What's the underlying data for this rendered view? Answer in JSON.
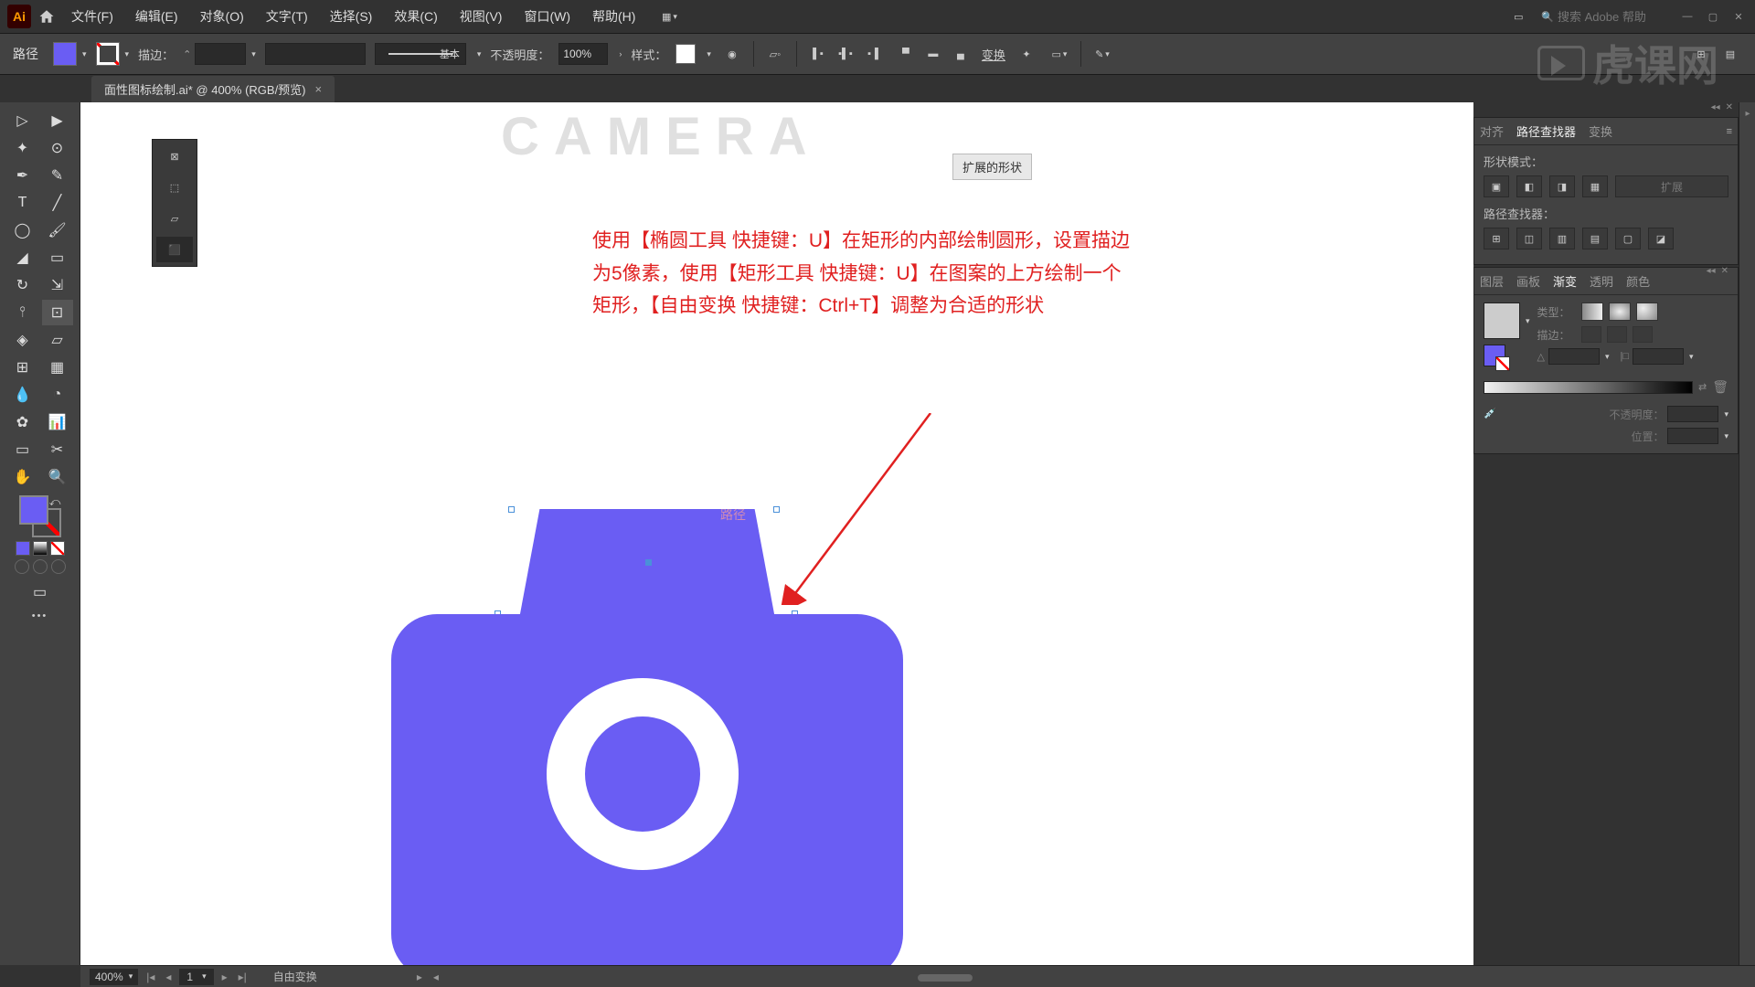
{
  "app": {
    "icon": "Ai"
  },
  "menubar": {
    "items": [
      "文件(F)",
      "编辑(E)",
      "对象(O)",
      "文字(T)",
      "选择(S)",
      "效果(C)",
      "视图(V)",
      "窗口(W)",
      "帮助(H)"
    ],
    "search_placeholder": "搜索 Adobe 帮助"
  },
  "controlbar": {
    "mode": "路径",
    "stroke_label": "描边：",
    "stroke_weight": "",
    "profile_label": "基本",
    "opacity_label": "不透明度：",
    "opacity_value": "100%",
    "style_label": "样式：",
    "transform_label": "变换"
  },
  "tab": {
    "title": "面性图标绘制.ai* @ 400% (RGB/预览)"
  },
  "canvas": {
    "bg_text": "CAMERA",
    "pill": "扩展的形状",
    "annotation_l1": "使用【椭圆工具 快捷键：U】在矩形的内部绘制圆形，设置描边",
    "annotation_l2": "为5像素，使用【矩形工具 快捷键：U】在图案的上方绘制一个",
    "annotation_l3": "矩形，【自由变换 快捷键：Ctrl+T】调整为合适的形状",
    "path_label": "路径"
  },
  "panels": {
    "group1": {
      "tabs": [
        "对齐",
        "路径查找器",
        "变换"
      ],
      "active": 1,
      "shape_mode": "形状模式：",
      "pathfinder": "路径查找器：",
      "expand": "扩展"
    },
    "group2": {
      "tabs": [
        "图层",
        "画板",
        "渐变",
        "透明",
        "颜色"
      ],
      "active": 2,
      "type_label": "类型：",
      "stroke_label": "描边：",
      "opacity_label": "不透明度：",
      "position_label": "位置："
    }
  },
  "statusbar": {
    "zoom": "400%",
    "artboard": "1",
    "tool": "自由变换"
  },
  "watermark": "虎课网"
}
